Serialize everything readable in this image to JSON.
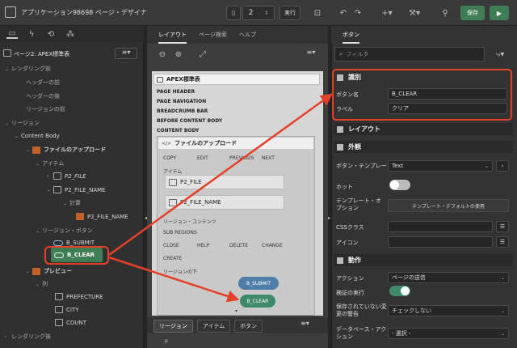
{
  "topbar": {
    "app_name": "アプリケーション98698",
    "separator": "\\",
    "page_title": "ページ・デザイナ",
    "page_number": "2",
    "run_label": "実行",
    "save_label": "保存"
  },
  "left": {
    "page_title": "ページ2: APEX標準表",
    "tree": {
      "pre_rendering": "レンダリング前",
      "before_header": "ヘッダーの前",
      "after_header": "ヘッダーの後",
      "before_region": "リージョンの前",
      "regions": "リージョン",
      "content_body": "Content Body",
      "file_upload": "ファイルのアップロード",
      "items": "アイテム",
      "p2_file": "P2_FILE",
      "p2_file_name": "P2_FILE_NAME",
      "calc": "計算",
      "p2_file_name_2": "P2_FILE_NAME",
      "region_buttons": "リージョン・ボタン",
      "b_submit": "B_SUBMIT",
      "b_clear": "B_CLEAR",
      "preview": "プレビュー",
      "columns": "列",
      "prefecture": "PREFECTURE",
      "city": "CITY",
      "count": "COUNT",
      "post_rendering": "レンダリング後"
    }
  },
  "mid": {
    "tabs": [
      "レイアウト",
      "ページ検索",
      "ヘルプ"
    ],
    "canvas": {
      "page_title": "APEX標準表",
      "page_header": "PAGE HEADER",
      "page_navigation": "PAGE NAVIGATION",
      "breadcrumb_bar": "BREADCRUMB BAR",
      "before_content_body": "BEFORE CONTENT BODY",
      "content_body": "CONTENT BODY",
      "region_title": "ファイルのアップロード",
      "toolbar": [
        "COPY",
        "EDIT",
        "PREVIOUS",
        "NEXT"
      ],
      "items_label": "アイテム",
      "item1": "P2_FILE",
      "item2": "P2_FILE_NAME",
      "region_content": "リージョン・コンテンツ",
      "sub_regions": "SUB REGIONS",
      "toolbar2": [
        "CLOSE",
        "HELP",
        "DELETE",
        "CHANGE"
      ],
      "create": "CREATE",
      "below_region": "リージョンの下",
      "btn_submit": "B_SUBMIT",
      "btn_clear": "B_CLEAR"
    },
    "bottom_tabs": [
      "リージョン",
      "アイテム",
      "ボタン"
    ],
    "bottom_text": "p"
  },
  "right": {
    "tab": "ボタン",
    "filter_placeholder": "フィルタ",
    "sec_identification": "識別",
    "lbl_button_name": "ボタン名",
    "val_button_name": "B_CLEAR",
    "lbl_label": "ラベル",
    "val_label": "クリア",
    "sec_layout": "レイアウト",
    "sec_appearance": "外観",
    "lbl_template": "ボタン・テンプレート",
    "val_template": "Text",
    "lbl_hot": "ホット",
    "lbl_template_options": "テンプレート・オプション",
    "btn_template_default": "テンプレート・デフォルトの使用",
    "lbl_css": "CSSクラス",
    "lbl_icon": "アイコン",
    "sec_behavior": "動作",
    "lbl_action": "アクション",
    "val_action": "ページの送信",
    "lbl_validation": "検証の実行",
    "lbl_unsaved": "保存されていない変更の警告",
    "val_unsaved": "チェックしない",
    "lbl_db_action": "データベース・アクション",
    "val_db_action": "- 選択 -"
  },
  "colors": {
    "highlight": "#e5412a",
    "accent_green": "#3f7d54",
    "button_blue": "#4f7fa8",
    "button_green": "#3f8a6a"
  }
}
